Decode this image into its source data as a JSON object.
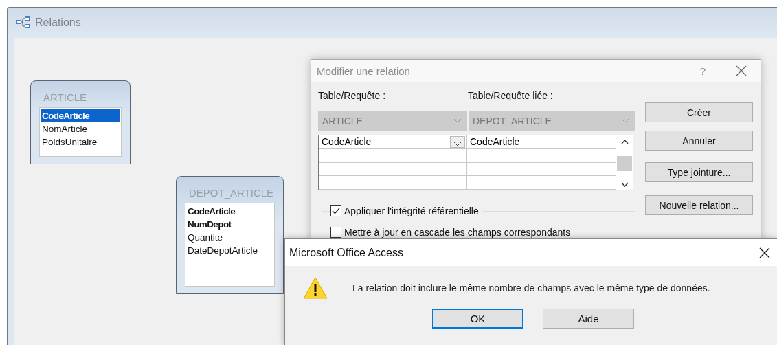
{
  "window": {
    "title": "Relations"
  },
  "tables": [
    {
      "name": "ARTICLE",
      "fields": [
        {
          "label": "CodeArticle",
          "key": true,
          "selected": true
        },
        {
          "label": "NomArticle",
          "key": false,
          "selected": false
        },
        {
          "label": "PoidsUnitaire",
          "key": false,
          "selected": false
        }
      ]
    },
    {
      "name": "DEPOT_ARTICLE",
      "fields": [
        {
          "label": "CodeArticle",
          "key": true,
          "selected": false
        },
        {
          "label": "NumDepot",
          "key": true,
          "selected": false
        },
        {
          "label": "Quantite",
          "key": false,
          "selected": false
        },
        {
          "label": "DateDepotArticle",
          "key": false,
          "selected": false
        }
      ]
    }
  ],
  "edit_dialog": {
    "title": "Modifier une relation",
    "help": "?",
    "table_label": "Table/Requête :",
    "related_label": "Table/Requête liée :",
    "table": "ARTICLE",
    "related_table": "DEPOT_ARTICLE",
    "grid_rows": [
      {
        "field": "CodeArticle",
        "related_field": "CodeArticle"
      }
    ],
    "options": [
      {
        "label": "Appliquer l'intégrité référentielle",
        "checked": true
      },
      {
        "label": "Mettre à jour en cascade les champs correspondants",
        "checked": false
      }
    ],
    "buttons": [
      "Créer",
      "Annuler",
      "Type jointure...",
      "Nouvelle relation..."
    ]
  },
  "message_box": {
    "title": "Microsoft Office Access",
    "message": "La relation doit inclure le même nombre de champs avec le même type de données.",
    "buttons": [
      {
        "label": "OK",
        "default": true
      },
      {
        "label": "Aide",
        "default": false
      }
    ]
  }
}
